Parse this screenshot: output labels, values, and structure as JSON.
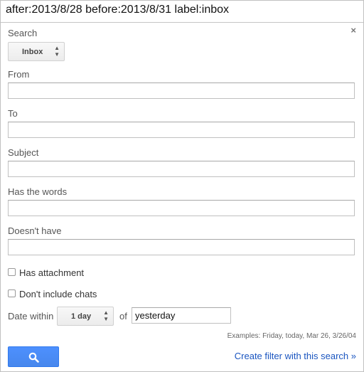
{
  "query": "after:2013/8/28 before:2013/8/31 label:inbox",
  "search_in": {
    "label": "Search",
    "selected": "Inbox"
  },
  "fields": [
    {
      "label": "From",
      "value": ""
    },
    {
      "label": "To",
      "value": ""
    },
    {
      "label": "Subject",
      "value": ""
    },
    {
      "label": "Has the words",
      "value": ""
    },
    {
      "label": "Doesn't have",
      "value": ""
    }
  ],
  "checkboxes": [
    {
      "label": "Has attachment",
      "checked": false
    },
    {
      "label": "Don't include chats",
      "checked": false
    }
  ],
  "date": {
    "label": "Date within",
    "range": "1 day",
    "of_label": "of",
    "value": "yesterday",
    "examples": "Examples: Friday, today, Mar 26, 3/26/04"
  },
  "actions": {
    "create_filter": "Create filter with this search »",
    "search_icon": "search-icon",
    "close_icon": "close-icon",
    "close_glyph": "×"
  },
  "colors": {
    "accent": "#4d90fe",
    "link": "#1a55c0"
  }
}
